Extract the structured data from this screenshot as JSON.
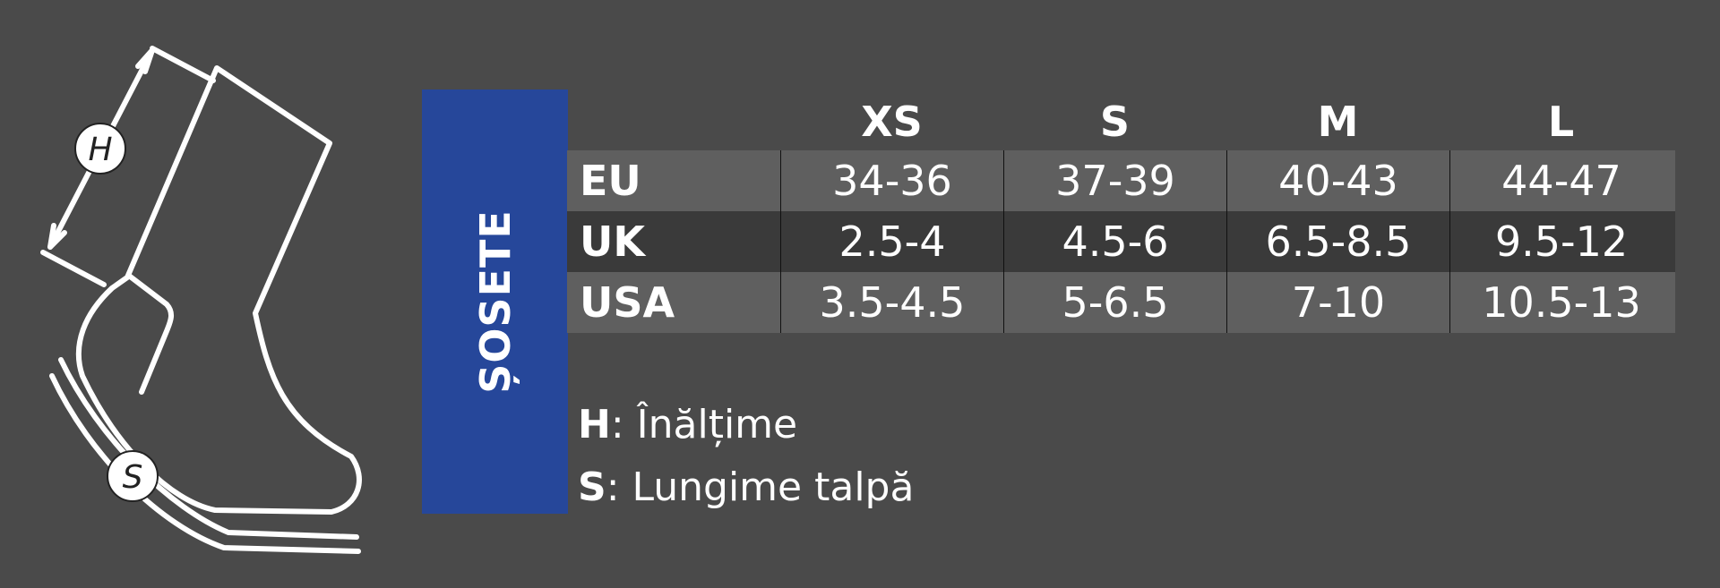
{
  "title": "ȘOSETE",
  "table": {
    "sizes": [
      "XS",
      "S",
      "M",
      "L"
    ],
    "rows": [
      {
        "label": "EU",
        "values": [
          "34-36",
          "37-39",
          "40-43",
          "44-47"
        ]
      },
      {
        "label": "UK",
        "values": [
          "2.5-4",
          "4.5-6",
          "6.5-8.5",
          "9.5-12"
        ]
      },
      {
        "label": "USA",
        "values": [
          "3.5-4.5",
          "5-6.5",
          "7-10",
          "10.5-13"
        ]
      }
    ]
  },
  "legend": {
    "h_key": "H",
    "h_text": ": Înălțime",
    "s_key": "S",
    "s_text": ": Lungime talpă"
  },
  "diagram": {
    "height_label": "H",
    "sole_label": "S"
  },
  "colors": {
    "background": "#4a4a4a",
    "title_bar": "#26479a",
    "row_light": "#5f5f5f",
    "row_dark": "#3a3a3a"
  }
}
